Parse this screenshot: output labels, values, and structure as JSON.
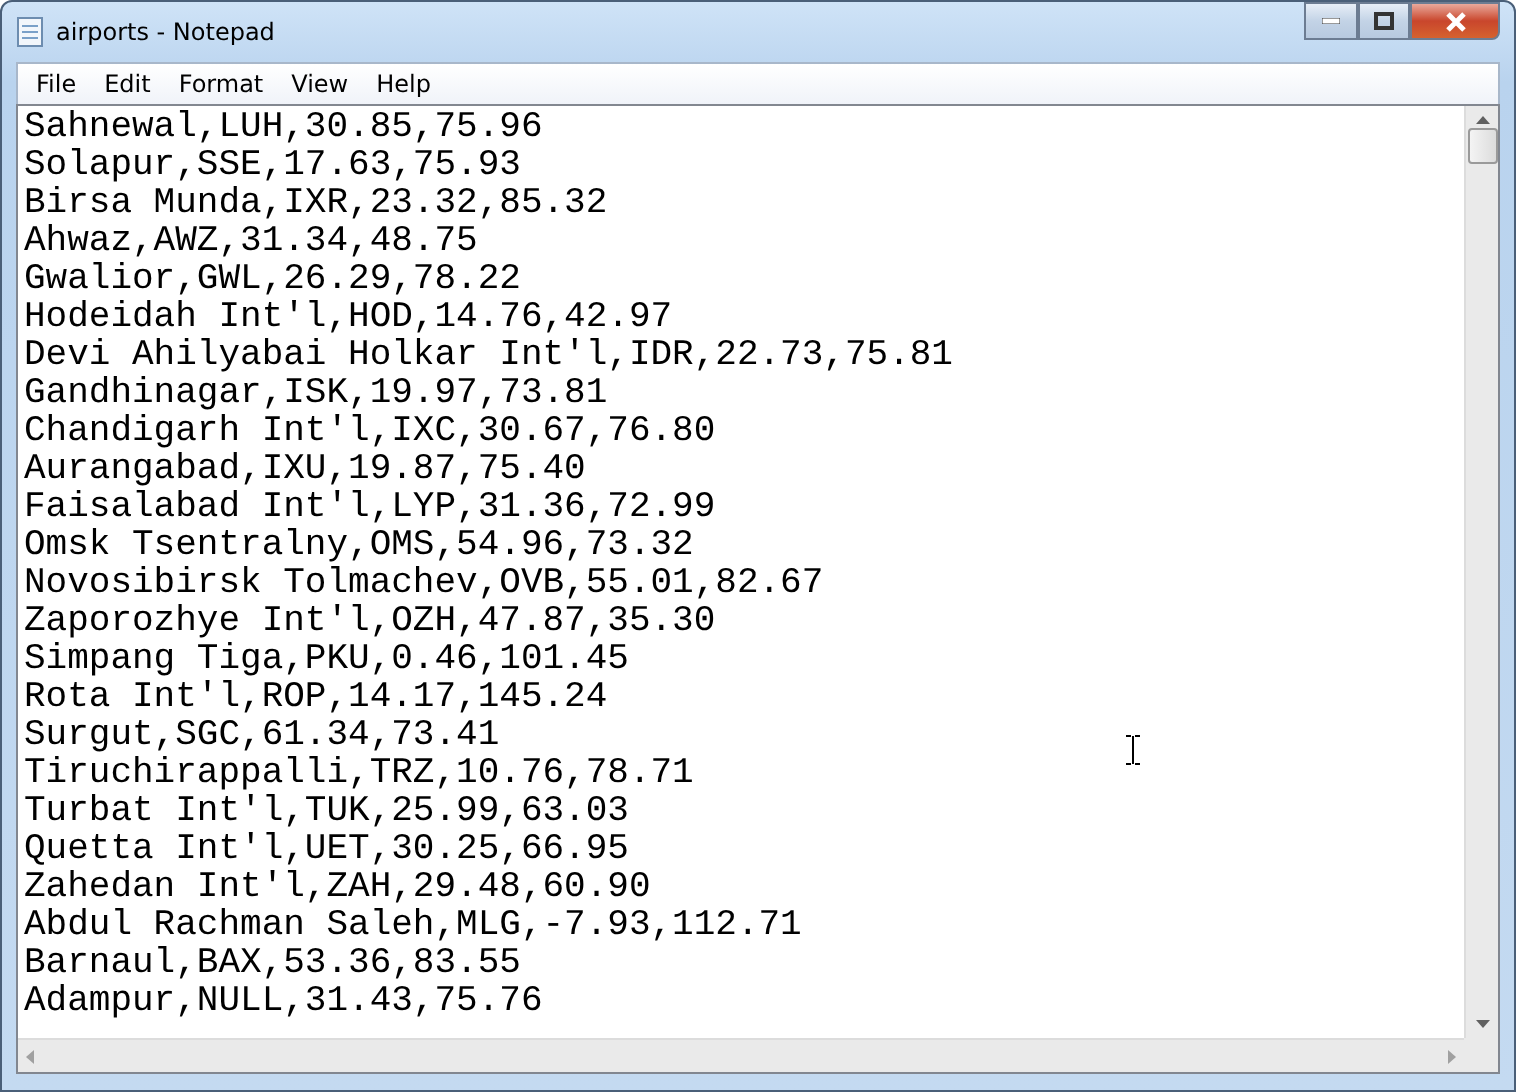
{
  "window": {
    "title": "airports - Notepad"
  },
  "menu": [
    "File",
    "Edit",
    "Format",
    "View",
    "Help"
  ],
  "lines": [
    "Sahnewal,LUH,30.85,75.96",
    "Solapur,SSE,17.63,75.93",
    "Birsa Munda,IXR,23.32,85.32",
    "Ahwaz,AWZ,31.34,48.75",
    "Gwalior,GWL,26.29,78.22",
    "Hodeidah Int'l,HOD,14.76,42.97",
    "Devi Ahilyabai Holkar Int'l,IDR,22.73,75.81",
    "Gandhinagar,ISK,19.97,73.81",
    "Chandigarh Int'l,IXC,30.67,76.80",
    "Aurangabad,IXU,19.87,75.40",
    "Faisalabad Int'l,LYP,31.36,72.99",
    "Omsk Tsentralny,OMS,54.96,73.32",
    "Novosibirsk Tolmachev,OVB,55.01,82.67",
    "Zaporozhye Int'l,OZH,47.87,35.30",
    "Simpang Tiga,PKU,0.46,101.45",
    "Rota Int'l,ROP,14.17,145.24",
    "Surgut,SGC,61.34,73.41",
    "Tiruchirappalli,TRZ,10.76,78.71",
    "Turbat Int'l,TUK,25.99,63.03",
    "Quetta Int'l,UET,30.25,66.95",
    "Zahedan Int'l,ZAH,29.48,60.90",
    "Abdul Rachman Saleh,MLG,-7.93,112.71",
    "Barnaul,BAX,53.36,83.55",
    "Adampur,NULL,31.43,75.76"
  ]
}
